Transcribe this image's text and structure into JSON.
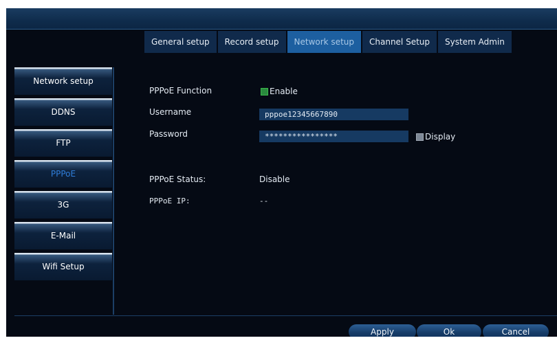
{
  "tabs": [
    {
      "label": "General setup",
      "active": false
    },
    {
      "label": "Record setup",
      "active": false
    },
    {
      "label": "Network setup",
      "active": true
    },
    {
      "label": "Channel Setup",
      "active": false
    },
    {
      "label": "System Admin",
      "active": false
    }
  ],
  "sidebar": {
    "items": [
      {
        "label": "Network setup",
        "active": false
      },
      {
        "label": "DDNS",
        "active": false
      },
      {
        "label": "FTP",
        "active": false
      },
      {
        "label": "PPPoE",
        "active": true
      },
      {
        "label": "3G",
        "active": false
      },
      {
        "label": "E-Mail",
        "active": false
      },
      {
        "label": "Wifi Setup",
        "active": false
      }
    ]
  },
  "form": {
    "pppoe_function_label": "PPPoE Function",
    "enable_label": "Enable",
    "enable_checked": true,
    "username_label": "Username",
    "username_value": "pppoe12345667890",
    "password_label": "Password",
    "password_value": "****************",
    "display_label": "Display",
    "display_checked": false
  },
  "status": {
    "status_label": "PPPoE Status:",
    "status_value": "Disable",
    "ip_label": "PPPoE IP:",
    "ip_value": "--"
  },
  "buttons": {
    "apply": "Apply",
    "ok": "Ok",
    "cancel": "Cancel"
  },
  "colors": {
    "background": "#050a14",
    "tab": "#102a4b",
    "tab_active": "#1d5fa0",
    "sidebar_active_text": "#2f7dd8",
    "field": "#163a62",
    "checkbox_enable": "#2a8a3e"
  }
}
